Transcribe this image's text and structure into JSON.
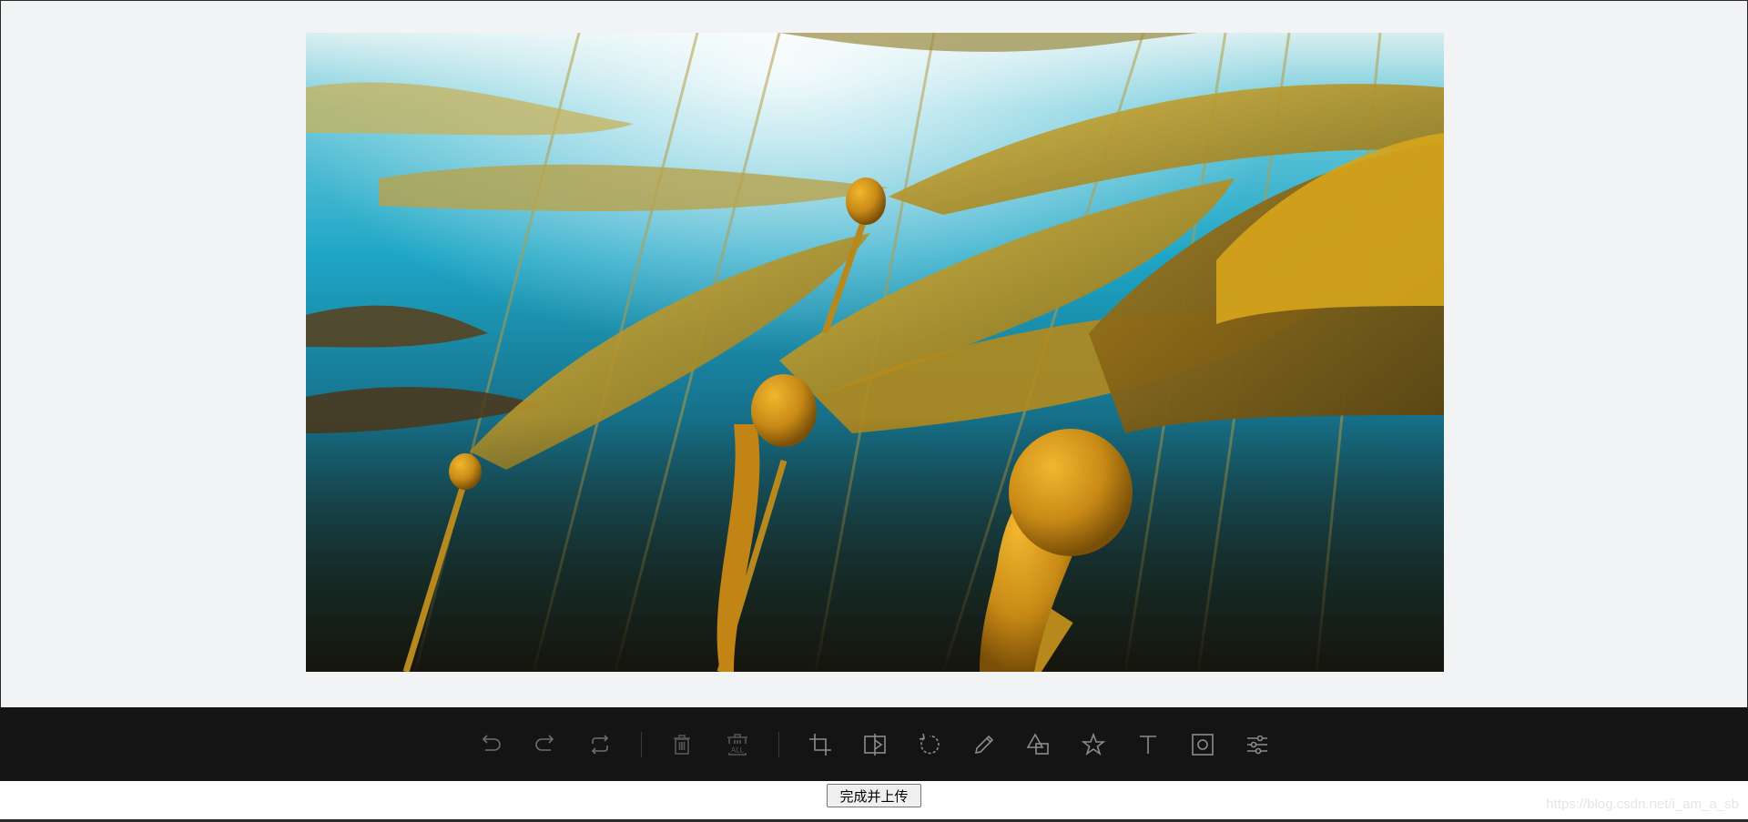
{
  "canvas": {
    "image_alt": "kelp-forest-photo"
  },
  "toolbar": {
    "groups": [
      [
        "undo-icon",
        "redo-icon",
        "reset-icon"
      ],
      [
        "delete-icon",
        "delete-all-icon"
      ],
      [
        "crop-icon",
        "flip-icon",
        "rotate-icon",
        "draw-icon",
        "shape-icon",
        "star-icon",
        "text-icon",
        "mask-icon",
        "filter-icon"
      ]
    ],
    "delete_all_badge": "ALL",
    "icon_color": "#8c8c8c",
    "background": "#141414"
  },
  "finish_button": {
    "label": "完成并上传"
  },
  "watermark": {
    "text": "https://blog.csdn.net/i_am_a_sb"
  }
}
